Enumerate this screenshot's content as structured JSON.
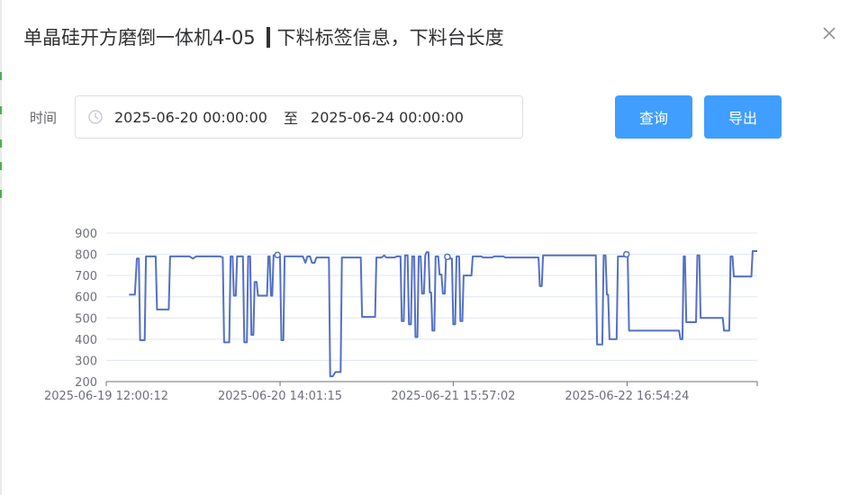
{
  "dialog": {
    "title_main": "单晶硅开方磨倒一体机4-05",
    "title_sub": "下料标签信息，下料台长度"
  },
  "filter": {
    "time_label": "时间",
    "start": "2025-06-20 00:00:00",
    "separator": "至",
    "end": "2025-06-24 00:00:00"
  },
  "buttons": {
    "query": "查询",
    "export": "导出"
  },
  "icons": {
    "close": "close-icon",
    "clock": "clock-icon"
  },
  "colors": {
    "primary": "#409eff",
    "series": "#5470c6",
    "grid": "#e0e6f1"
  },
  "chart_data": {
    "type": "line",
    "ylim": [
      200,
      900
    ],
    "yticks": [
      200,
      300,
      400,
      500,
      600,
      700,
      800,
      900
    ],
    "xlim": [
      0,
      100
    ],
    "xtick_labels": [
      {
        "x": 0,
        "label": "2025-06-19 12:00:12"
      },
      {
        "x": 26.7,
        "label": "2025-06-20 14:01:15"
      },
      {
        "x": 53.3,
        "label": "2025-06-21 15:57:02"
      },
      {
        "x": 80,
        "label": "2025-06-22 16:54:24"
      }
    ],
    "grid": true,
    "series": [
      {
        "points": [
          [
            3.5,
            610
          ],
          [
            4.4,
            610
          ],
          [
            4.7,
            780
          ],
          [
            5.0,
            780
          ],
          [
            5.2,
            395
          ],
          [
            5.9,
            395
          ],
          [
            6.1,
            790
          ],
          [
            7.6,
            790
          ],
          [
            7.8,
            540
          ],
          [
            9.6,
            540
          ],
          [
            9.8,
            790
          ],
          [
            12.8,
            790
          ],
          [
            13.3,
            780
          ],
          [
            13.8,
            790
          ],
          [
            17.5,
            790
          ],
          [
            17.9,
            785
          ],
          [
            18.1,
            385
          ],
          [
            18.9,
            385
          ],
          [
            19.1,
            790
          ],
          [
            19.4,
            790
          ],
          [
            19.6,
            605
          ],
          [
            19.9,
            605
          ],
          [
            20.1,
            790
          ],
          [
            21.0,
            790
          ],
          [
            21.2,
            385
          ],
          [
            21.6,
            385
          ],
          [
            21.8,
            790
          ],
          [
            22.1,
            790
          ],
          [
            22.3,
            420
          ],
          [
            22.6,
            420
          ],
          [
            22.8,
            670
          ],
          [
            23.1,
            670
          ],
          [
            23.3,
            605
          ],
          [
            24.7,
            605
          ],
          [
            24.9,
            790
          ],
          [
            25.1,
            790
          ],
          [
            25.3,
            605
          ],
          [
            25.5,
            605
          ],
          [
            25.7,
            795
          ],
          [
            26.2,
            795
          ],
          [
            26.4,
            790
          ],
          [
            26.7,
            790
          ],
          [
            26.9,
            395
          ],
          [
            27.2,
            395
          ],
          [
            27.4,
            790
          ],
          [
            30.2,
            790
          ],
          [
            30.6,
            760
          ],
          [
            30.9,
            790
          ],
          [
            31.3,
            790
          ],
          [
            31.6,
            760
          ],
          [
            32.0,
            760
          ],
          [
            32.3,
            785
          ],
          [
            34.2,
            785
          ],
          [
            34.4,
            225
          ],
          [
            34.8,
            225
          ],
          [
            35.2,
            245
          ],
          [
            36.0,
            245
          ],
          [
            36.2,
            785
          ],
          [
            39.1,
            785
          ],
          [
            39.3,
            505
          ],
          [
            41.3,
            505
          ],
          [
            41.5,
            785
          ],
          [
            42.3,
            785
          ],
          [
            42.7,
            795
          ],
          [
            43.0,
            785
          ],
          [
            44.3,
            785
          ],
          [
            44.6,
            790
          ],
          [
            45.2,
            790
          ],
          [
            45.4,
            485
          ],
          [
            45.7,
            485
          ],
          [
            45.9,
            795
          ],
          [
            46.3,
            795
          ],
          [
            46.5,
            470
          ],
          [
            46.8,
            470
          ],
          [
            47.0,
            790
          ],
          [
            47.3,
            790
          ],
          [
            47.5,
            410
          ],
          [
            47.8,
            410
          ],
          [
            48.0,
            790
          ],
          [
            48.3,
            790
          ],
          [
            48.5,
            615
          ],
          [
            48.8,
            615
          ],
          [
            49.0,
            795
          ],
          [
            49.2,
            810
          ],
          [
            49.5,
            810
          ],
          [
            49.7,
            620
          ],
          [
            49.9,
            620
          ],
          [
            50.1,
            440
          ],
          [
            50.4,
            440
          ],
          [
            50.6,
            790
          ],
          [
            51.0,
            790
          ],
          [
            51.2,
            705
          ],
          [
            51.5,
            705
          ],
          [
            51.7,
            615
          ],
          [
            52.0,
            615
          ],
          [
            52.2,
            790
          ],
          [
            52.5,
            790
          ],
          [
            52.7,
            780
          ],
          [
            53.1,
            780
          ],
          [
            53.3,
            470
          ],
          [
            53.6,
            470
          ],
          [
            53.8,
            790
          ],
          [
            54.2,
            790
          ],
          [
            54.4,
            485
          ],
          [
            54.7,
            485
          ],
          [
            54.9,
            700
          ],
          [
            56.1,
            700
          ],
          [
            56.3,
            790
          ],
          [
            57.6,
            790
          ],
          [
            57.9,
            785
          ],
          [
            59.3,
            785
          ],
          [
            59.6,
            790
          ],
          [
            61.0,
            790
          ],
          [
            61.3,
            785
          ],
          [
            66.4,
            785
          ],
          [
            66.6,
            650
          ],
          [
            66.9,
            650
          ],
          [
            67.1,
            795
          ],
          [
            75.2,
            795
          ],
          [
            75.4,
            375
          ],
          [
            76.2,
            375
          ],
          [
            76.4,
            795
          ],
          [
            76.7,
            795
          ],
          [
            76.9,
            610
          ],
          [
            77.1,
            610
          ],
          [
            77.3,
            400
          ],
          [
            78.4,
            400
          ],
          [
            78.6,
            790
          ],
          [
            79.6,
            790
          ],
          [
            79.8,
            800
          ],
          [
            80.1,
            800
          ],
          [
            80.3,
            440
          ],
          [
            88.0,
            440
          ],
          [
            88.2,
            400
          ],
          [
            88.5,
            400
          ],
          [
            88.7,
            790
          ],
          [
            88.9,
            790
          ],
          [
            89.1,
            480
          ],
          [
            90.6,
            480
          ],
          [
            90.8,
            795
          ],
          [
            91.1,
            795
          ],
          [
            91.3,
            500
          ],
          [
            94.7,
            500
          ],
          [
            94.9,
            440
          ],
          [
            95.7,
            440
          ],
          [
            95.9,
            790
          ],
          [
            96.2,
            790
          ],
          [
            96.4,
            695
          ],
          [
            99.1,
            695
          ],
          [
            99.3,
            815
          ],
          [
            100,
            815
          ]
        ],
        "markers": [
          [
            26.3,
            797
          ],
          [
            52.4,
            788
          ],
          [
            79.9,
            800
          ]
        ]
      }
    ]
  }
}
